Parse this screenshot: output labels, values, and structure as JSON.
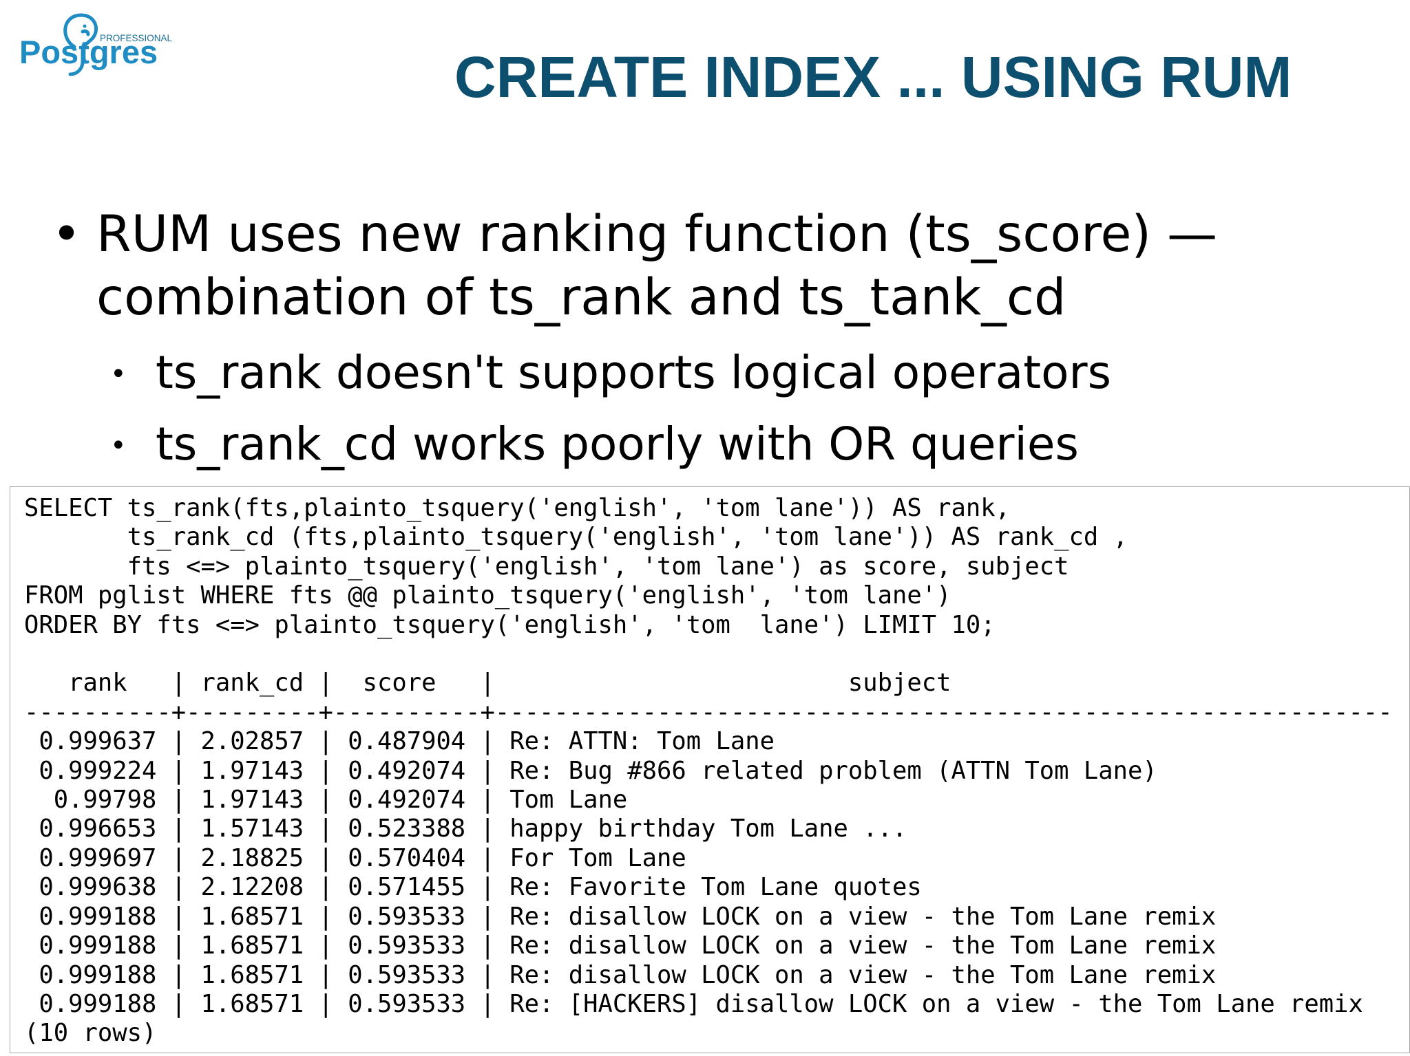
{
  "logo": {
    "brand_text": "Postgres",
    "tag_text": "PROFESSIONAL",
    "icon": "elephant-icon",
    "colors": {
      "brand": "#1f8cc4",
      "tag": "#1a6e9a"
    }
  },
  "title": "CREATE INDEX ... USING RUM",
  "title_color": "#0c4f6e",
  "bullets": [
    {
      "text": "RUM uses new ranking function (ts_score) — combination of ts_rank and ts_tank_cd",
      "sub_bullets": [
        "ts_rank doesn't supports logical operators",
        "ts_rank_cd works poorly with OR queries"
      ]
    }
  ],
  "code": {
    "query_lines": [
      "SELECT ts_rank(fts,plainto_tsquery('english', 'tom lane')) AS rank,",
      "       ts_rank_cd (fts,plainto_tsquery('english', 'tom lane')) AS rank_cd ,",
      "       fts <=> plainto_tsquery('english', 'tom lane') as score, subject",
      "FROM pglist WHERE fts @@ plainto_tsquery('english', 'tom lane')",
      "ORDER BY fts <=> plainto_tsquery('english', 'tom  lane') LIMIT 10;"
    ],
    "result_header": "   rank   | rank_cd |  score   |                        subject",
    "result_separator": "----------+---------+----------+-------------------------------------------------------------",
    "result_rows": [
      " 0.999637 | 2.02857 | 0.487904 | Re: ATTN: Tom Lane",
      " 0.999224 | 1.97143 | 0.492074 | Re: Bug #866 related problem (ATTN Tom Lane)",
      "  0.99798 | 1.97143 | 0.492074 | Tom Lane",
      " 0.996653 | 1.57143 | 0.523388 | happy birthday Tom Lane ...",
      " 0.999697 | 2.18825 | 0.570404 | For Tom Lane",
      " 0.999638 | 2.12208 | 0.571455 | Re: Favorite Tom Lane quotes",
      " 0.999188 | 1.68571 | 0.593533 | Re: disallow LOCK on a view - the Tom Lane remix",
      " 0.999188 | 1.68571 | 0.593533 | Re: disallow LOCK on a view - the Tom Lane remix",
      " 0.999188 | 1.68571 | 0.593533 | Re: disallow LOCK on a view - the Tom Lane remix",
      " 0.999188 | 1.68571 | 0.593533 | Re: [HACKERS] disallow LOCK on a view - the Tom Lane remix"
    ],
    "row_count": "(10 rows)"
  }
}
